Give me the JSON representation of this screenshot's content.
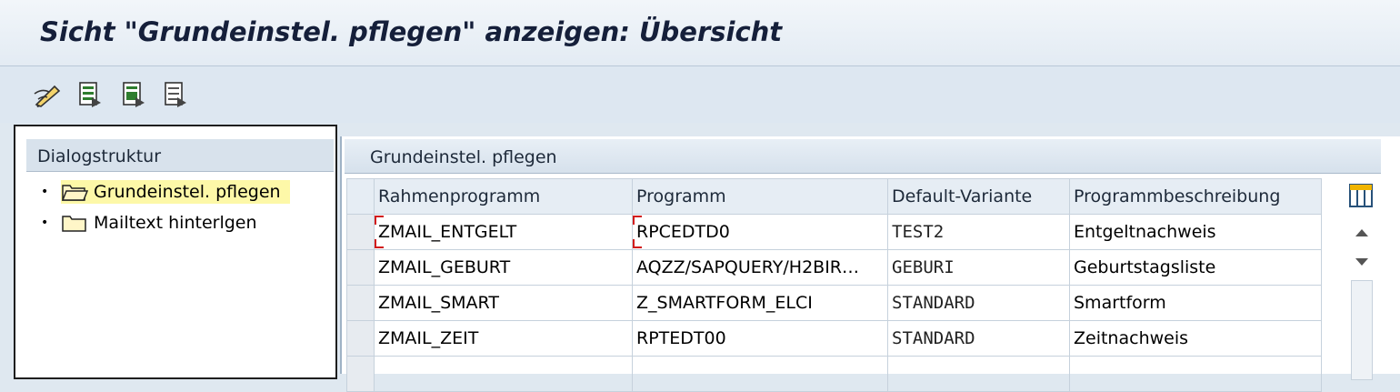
{
  "window": {
    "title": "Sicht \"Grundeinstel. pflegen\" anzeigen: Übersicht"
  },
  "toolbar": {
    "buttons": [
      {
        "icon": "display-change-icon"
      },
      {
        "icon": "select-all-icon"
      },
      {
        "icon": "select-block-icon"
      },
      {
        "icon": "deselect-all-icon"
      }
    ]
  },
  "dialog_structure": {
    "header": "Dialogstruktur",
    "items": [
      {
        "label": "Grundeinstel. pflegen",
        "selected": true,
        "icon": "folder-open-icon"
      },
      {
        "label": "Mailtext hinterlgen",
        "selected": false,
        "icon": "folder-icon"
      }
    ]
  },
  "table": {
    "title": "Grundeinstel. pflegen",
    "columns": [
      "Rahmenprogramm",
      "Programm",
      "Default-Variante",
      "Programmbeschreibung"
    ],
    "rows": [
      [
        "ZMAIL_ENTGELT",
        "RPCEDTD0",
        "TEST2",
        "Entgeltnachweis"
      ],
      [
        "ZMAIL_GEBURT",
        "AQZZ/SAPQUERY/H2BIR…",
        "GEBURI",
        "Geburtstagsliste"
      ],
      [
        "ZMAIL_SMART",
        "Z_SMARTFORM_ELCI",
        "STANDARD",
        "Smartform"
      ],
      [
        "ZMAIL_ZEIT",
        "RPTEDT00",
        "STANDARD",
        "Zeitnachweis"
      ],
      [
        "",
        "",
        "",
        ""
      ]
    ]
  },
  "colors": {
    "accent": "#151f3a",
    "selection": "#fdf8a8",
    "focus": "#d21c1c"
  }
}
